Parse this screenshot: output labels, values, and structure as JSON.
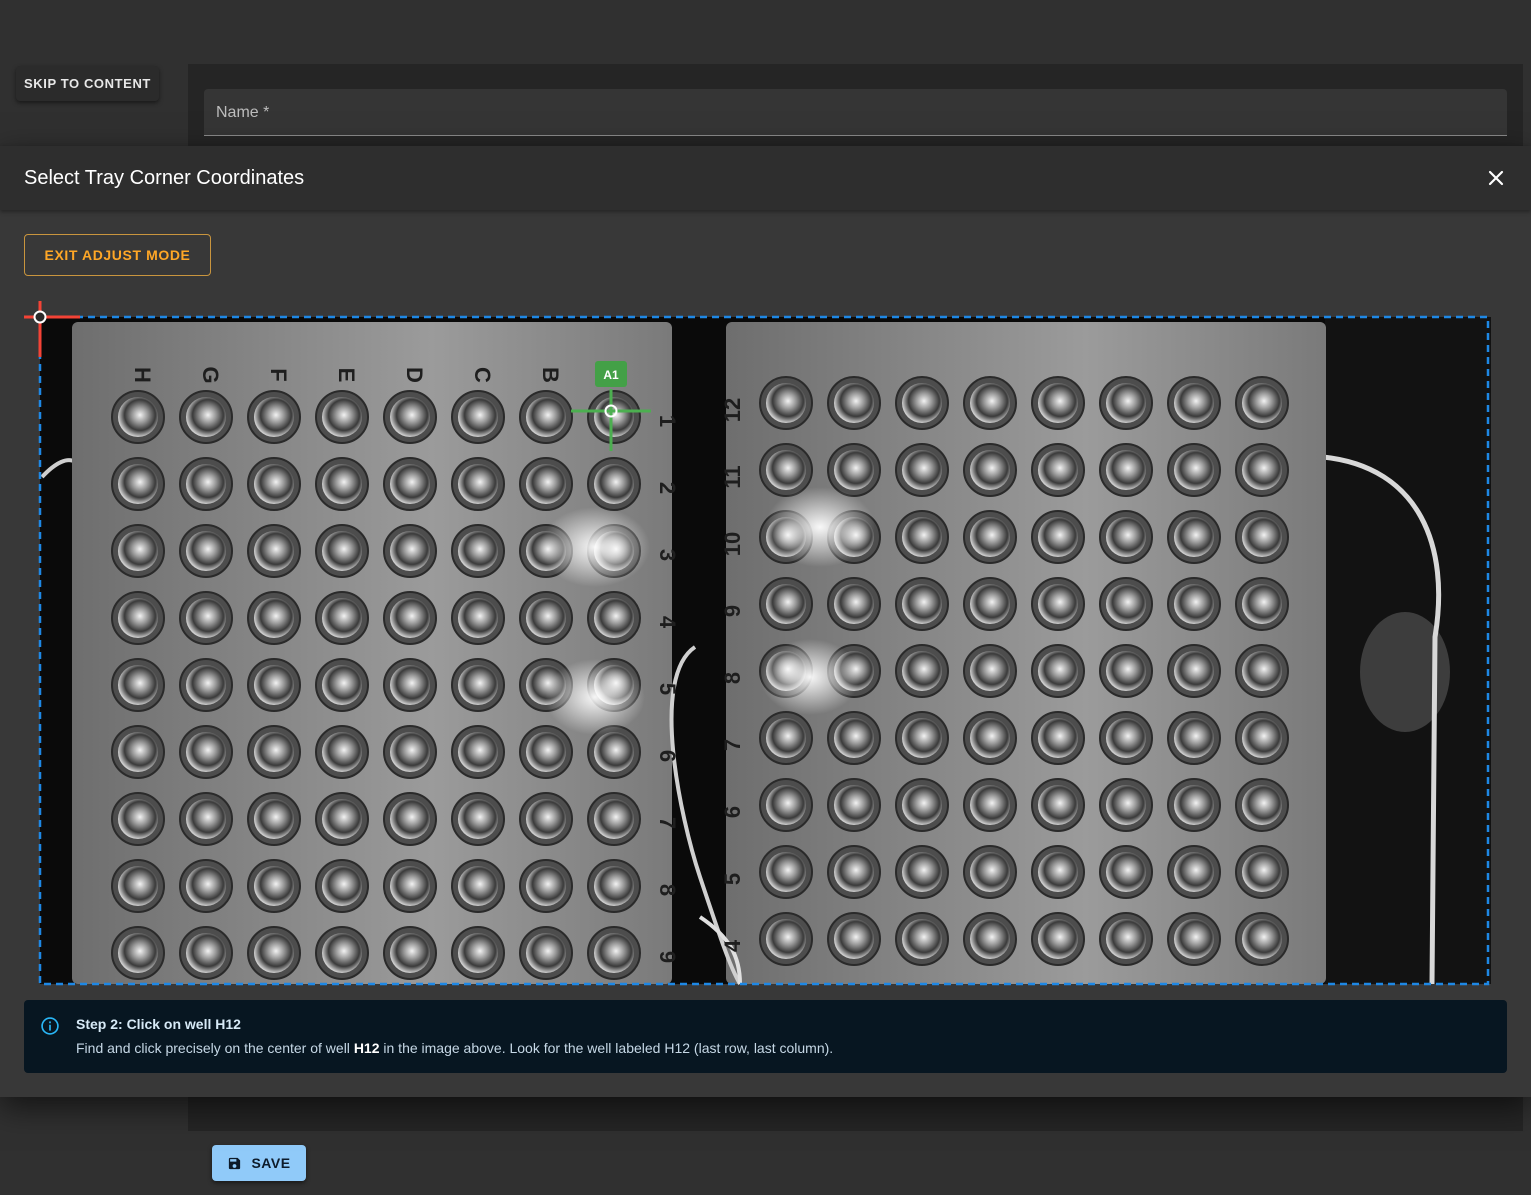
{
  "skip_link": {
    "label": "SKIP TO CONTENT"
  },
  "form": {
    "name_label": "Name *",
    "save_label": "SAVE"
  },
  "dialog": {
    "title": "Select Tray Corner Coordinates",
    "exit_button": "EXIT ADJUST MODE",
    "marker_label": "A1",
    "row_letters": [
      "H",
      "G",
      "F",
      "E",
      "D",
      "C",
      "B"
    ],
    "left_plate_numbers": [
      "1",
      "2",
      "3",
      "4",
      "5",
      "6",
      "7",
      "8",
      "9"
    ],
    "right_plate_numbers": [
      "12",
      "11",
      "10",
      "9",
      "8",
      "7",
      "6",
      "5",
      "4"
    ],
    "alert": {
      "title": "Step 2: Click on well H12",
      "body_prefix": "Find and click precisely on the center of well ",
      "body_well": "H12",
      "body_suffix": " in the image above. Look for the well labeled H12 (last row, last column)."
    }
  },
  "colors": {
    "accent": "#ffa726",
    "primary": "#90caf9",
    "marker_green": "#4caf50",
    "corner_red": "#f44336",
    "selection_blue": "#1e88e5"
  },
  "icons": [
    "close-icon",
    "save-icon",
    "info-icon",
    "crosshair-icon"
  ]
}
